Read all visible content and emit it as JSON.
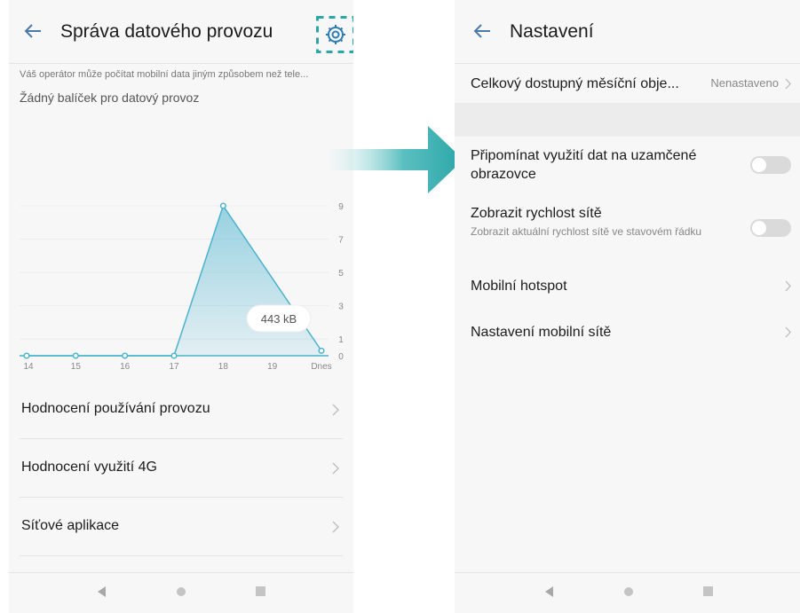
{
  "left": {
    "title": "Správa datového provozu",
    "operator_note": "Váš operátor může počítat mobilní data jiným způsobem než tele...",
    "no_package": "Žádný balíček pro datový provoz",
    "list": [
      {
        "label": "Hodnocení používání provozu"
      },
      {
        "label": "Hodnocení využití 4G"
      },
      {
        "label": "Síťové aplikace"
      }
    ]
  },
  "chart_data": {
    "type": "area",
    "categories": [
      "14",
      "15",
      "16",
      "17",
      "18",
      "19",
      "Dnes"
    ],
    "values": [
      0,
      0,
      0,
      0,
      9,
      null,
      0.3
    ],
    "y_ticks": [
      "9",
      "7",
      "5",
      "3",
      "1",
      "0"
    ],
    "ylim": [
      0,
      9
    ],
    "tooltip": "443 kB",
    "grid": true,
    "color": "#4ab2cf"
  },
  "right": {
    "title": "Nastavení",
    "monthly_total_label": "Celkový dostupný měsíční obje...",
    "monthly_total_value": "Nenastaveno",
    "remind_label": "Připomínat využití dat na uzamčené obrazovce",
    "remind_on": false,
    "speed_label": "Zobrazit rychlost sítě",
    "speed_sub": "Zobrazit aktuální rychlost sítě ve stavovém řádku",
    "speed_on": false,
    "hotspot_label": "Mobilní hotspot",
    "mobile_net_label": "Nastavení mobilní sítě"
  },
  "colors": {
    "accent": "#2aa6a8",
    "arrow_start": "#dff2f2",
    "arrow_end": "#2aa6a8"
  }
}
